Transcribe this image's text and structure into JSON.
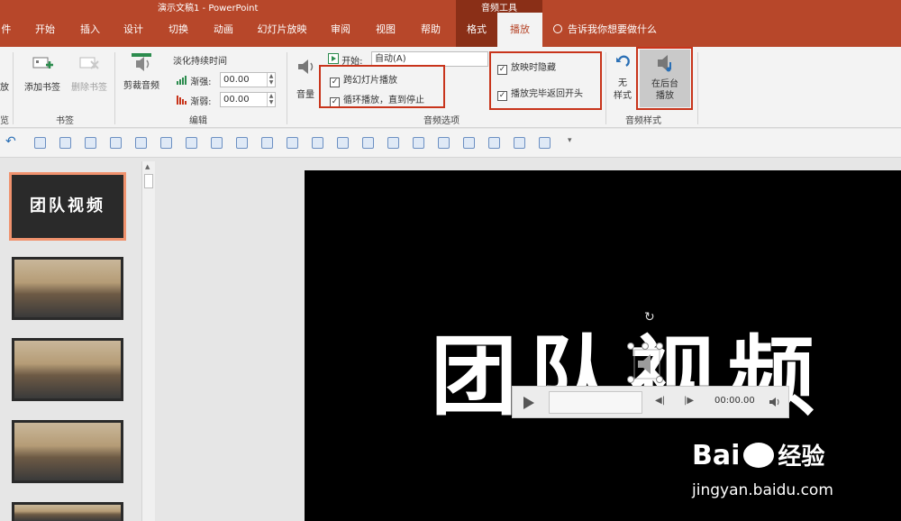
{
  "titlebar": {
    "title": "演示文稿1  -  PowerPoint",
    "context_group": "音频工具"
  },
  "tabs": [
    {
      "label": "件"
    },
    {
      "label": "开始"
    },
    {
      "label": "插入"
    },
    {
      "label": "设计"
    },
    {
      "label": "切换"
    },
    {
      "label": "动画"
    },
    {
      "label": "幻灯片放映"
    },
    {
      "label": "审阅"
    },
    {
      "label": "视图"
    },
    {
      "label": "帮助"
    },
    {
      "label": "格式"
    },
    {
      "label": "播放"
    }
  ],
  "tell_me": "告诉我你想要做什么",
  "ribbon": {
    "bookmarks": {
      "add": "添加书签",
      "remove": "删除书签",
      "group": "书签"
    },
    "edit": {
      "trim": "剪裁音频",
      "fade_title": "淡化持续时间",
      "fade_in_label": "渐强:",
      "fade_in_value": "00.00",
      "fade_out_label": "渐弱:",
      "fade_out_value": "00.00",
      "group": "编辑"
    },
    "options": {
      "volume": "音量",
      "start_label": "开始:",
      "start_value": "自动(A)",
      "cross_slides": "跨幻灯片播放",
      "loop": "循环播放，直到停止",
      "hide_during_show": "放映时隐藏",
      "rewind": "播放完毕返回开头",
      "group": "音频选项"
    },
    "styles": {
      "no_style": "无\n样式",
      "background_play": "在后台播放",
      "group": "音频样式"
    },
    "left_cut": "放",
    "left_group": "览"
  },
  "slides": [
    {
      "title": "团队视频"
    }
  ],
  "slide_main_title": "团队视频",
  "player": {
    "time": "00:00.00"
  },
  "watermark": {
    "brand": "Bai",
    "brand2": "经验",
    "url": "jingyan.baidu.com"
  },
  "colors": {
    "accent": "#b7472a",
    "highlight": "#c8341b"
  }
}
